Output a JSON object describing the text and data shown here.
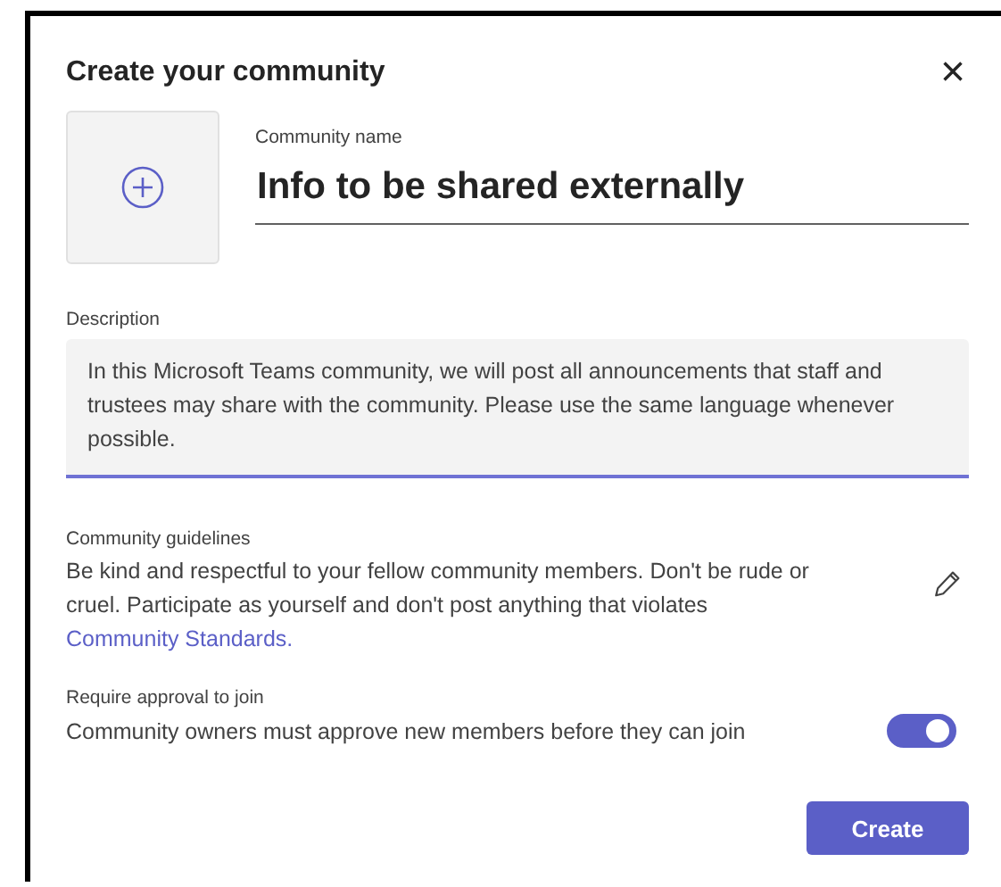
{
  "dialog": {
    "title": "Create your community",
    "close": "×",
    "name_field": {
      "label": "Community name",
      "value": "Info to be shared externally"
    },
    "description": {
      "label": "Description",
      "value": "In this Microsoft Teams community, we will post all announcements that staff and trustees may share with the community. Please use the same language whenever possible."
    },
    "guidelines": {
      "label": "Community guidelines",
      "text": "Be kind and respectful to your fellow community members. Don't be rude or cruel. Participate as yourself and don't post anything that violates ",
      "link": "Community Standards."
    },
    "approval": {
      "label": "Require approval to join",
      "text": "Community owners must approve new members before they can join",
      "on": true
    },
    "buttons": [
      {
        "label": "Create",
        "kind": "primary"
      }
    ]
  }
}
